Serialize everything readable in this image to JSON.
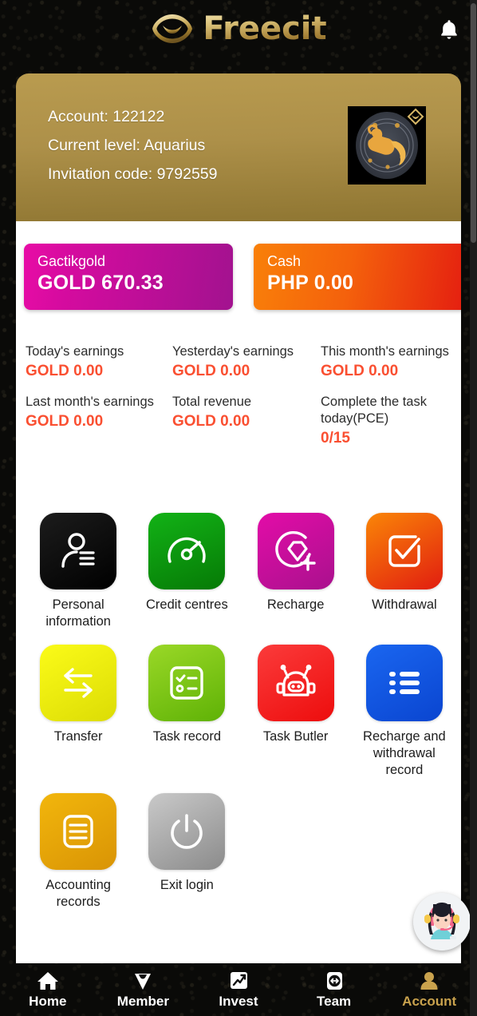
{
  "header": {
    "logo_text": "Freecit",
    "logo_icon": "freecit-leaf-logo-icon",
    "bell_icon": "bell-icon"
  },
  "account_card": {
    "account_line": "Account: 122122",
    "level_line": "Current level: Aquarius",
    "invitation_line": "Invitation code: 9792559",
    "avatar_icon": "aquarius-zodiac-avatar"
  },
  "balances": [
    {
      "label": "Gactikgold",
      "value": "GOLD 670.33",
      "color": "#d50b9f"
    },
    {
      "label": "Cash",
      "value": "PHP 0.00",
      "color": "#f4610c"
    }
  ],
  "stats": [
    {
      "label": "Today's earnings",
      "value": "GOLD 0.00"
    },
    {
      "label": "Yesterday's earnings",
      "value": "GOLD 0.00"
    },
    {
      "label": "This month's earnings",
      "value": "GOLD 0.00"
    },
    {
      "label": "Last month's earnings",
      "value": "GOLD 0.00"
    },
    {
      "label": "Total revenue",
      "value": "GOLD 0.00"
    },
    {
      "label": "Complete the task today(PCE)",
      "value": "0/15"
    }
  ],
  "stats_value_color": "#fa4f31",
  "menu_tiles": [
    {
      "label": "Personal information",
      "icon": "person-info-icon",
      "color": "#0a0a0a"
    },
    {
      "label": "Credit centres",
      "icon": "speedometer-icon",
      "color": "#0f9d12"
    },
    {
      "label": "Recharge",
      "icon": "diamond-plus-icon",
      "color": "#d50b9f"
    },
    {
      "label": "Withdrawal",
      "icon": "check-square-icon",
      "color": "#f4610c"
    },
    {
      "label": "Transfer",
      "icon": "transfer-arrows-icon",
      "color": "#ecec0c"
    },
    {
      "label": "Task record",
      "icon": "checklist-icon",
      "color": "#7dc514"
    },
    {
      "label": "Task Butler",
      "icon": "robot-icon",
      "color": "#f32222"
    },
    {
      "label": "Recharge and withdrawal record",
      "icon": "list-lines-icon",
      "color": "#1558e8"
    },
    {
      "label": "Accounting records",
      "icon": "document-lines-icon",
      "color": "#e8a80a"
    },
    {
      "label": "Exit login",
      "icon": "power-icon",
      "color": "#9d9d9d"
    }
  ],
  "support": {
    "icon": "customer-service-agent-icon"
  },
  "bottom_nav": [
    {
      "label": "Home",
      "icon": "home-icon",
      "active": false
    },
    {
      "label": "Member",
      "icon": "diamond-icon",
      "active": false
    },
    {
      "label": "Invest",
      "icon": "chart-up-icon",
      "active": false
    },
    {
      "label": "Team",
      "icon": "team-arrows-icon",
      "active": false
    },
    {
      "label": "Account",
      "icon": "person-icon",
      "active": true
    }
  ],
  "nav_active_color": "#c9a24d"
}
